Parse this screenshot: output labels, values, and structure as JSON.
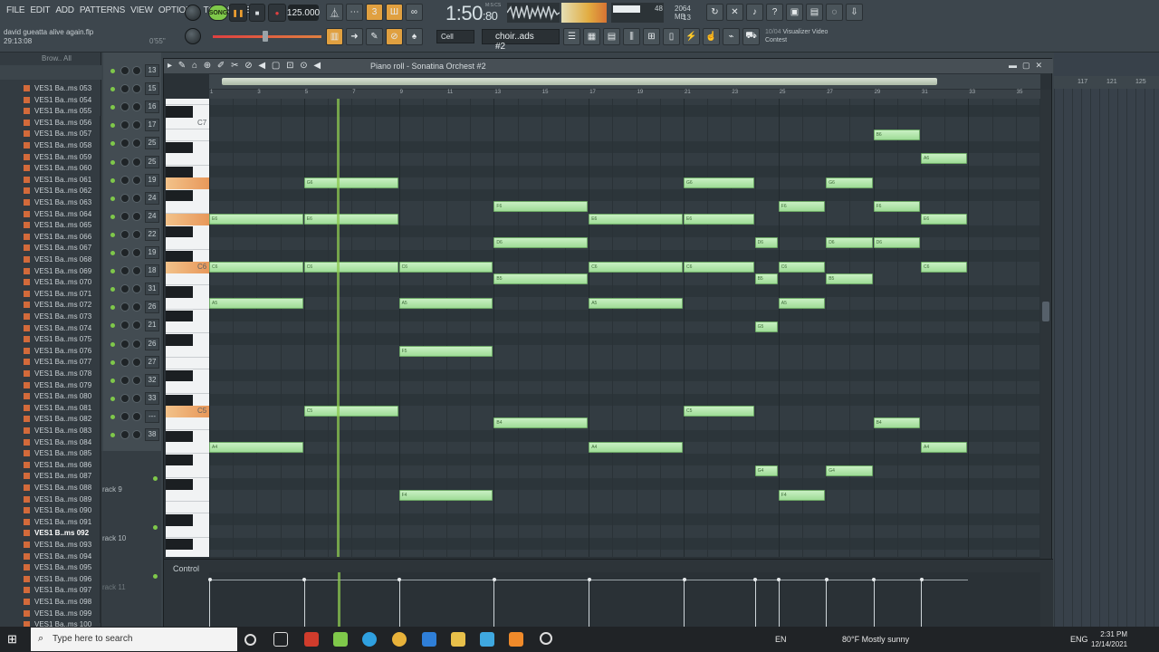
{
  "menu": [
    "FILE",
    "EDIT",
    "ADD",
    "PATTERNS",
    "VIEW",
    "OPTIONS",
    "TOOLS",
    "HELP"
  ],
  "project": {
    "name": "david gueatta alive again.flp",
    "time": "29:13:08",
    "time_right": "0'55\""
  },
  "transport": {
    "song_label": "SONG",
    "tempo": "125.000",
    "time": "1:50",
    "time_small": ":80",
    "time_units": "M:S:CS"
  },
  "cpu": {
    "value": "48",
    "polyphony": "13"
  },
  "memory": {
    "mb": "2064 MB"
  },
  "snap": "Cell",
  "pattern": "choir..ads #2",
  "hint": {
    "counter": "10/04",
    "text": "Visualizer Video",
    "text2": "Contest"
  },
  "browser": {
    "header": "Brow.. All",
    "items": [
      "VES1 Ba..ms 053",
      "VES1 Ba..ms 054",
      "VES1 Ba..ms 055",
      "VES1 Ba..ms 056",
      "VES1 Ba..ms 057",
      "VES1 Ba..ms 058",
      "VES1 Ba..ms 059",
      "VES1 Ba..ms 060",
      "VES1 Ba..ms 061",
      "VES1 Ba..ms 062",
      "VES1 Ba..ms 063",
      "VES1 Ba..ms 064",
      "VES1 Ba..ms 065",
      "VES1 Ba..ms 066",
      "VES1 Ba..ms 067",
      "VES1 Ba..ms 068",
      "VES1 Ba..ms 069",
      "VES1 Ba..ms 070",
      "VES1 Ba..ms 071",
      "VES1 Ba..ms 072",
      "VES1 Ba..ms 073",
      "VES1 Ba..ms 074",
      "VES1 Ba..ms 075",
      "VES1 Ba..ms 076",
      "VES1 Ba..ms 077",
      "VES1 Ba..ms 078",
      "VES1 Ba..ms 079",
      "VES1 Ba..ms 080",
      "VES1 Ba..ms 081",
      "VES1 Ba..ms 082",
      "VES1 Ba..ms 083",
      "VES1 Ba..ms 084",
      "VES1 Ba..ms 085",
      "VES1 Ba..ms 086",
      "VES1 Ba..ms 087",
      "VES1 Ba..ms 088",
      "VES1 Ba..ms 089",
      "VES1 Ba..ms 090",
      "VES1 Ba..ms 091",
      "VES1 B..ms 092",
      "VES1 Ba..ms 093",
      "VES1 Ba..ms 094",
      "VES1 Ba..ms 095",
      "VES1 Ba..ms 096",
      "VES1 Ba..ms 097",
      "VES1 Ba..ms 098",
      "VES1 Ba..ms 099",
      "VES1 Ba..ms 100"
    ],
    "selected_index": 39
  },
  "channels": [
    "13",
    "15",
    "16",
    "17",
    "25",
    "25",
    "19",
    "24",
    "24",
    "22",
    "19",
    "18",
    "31",
    "26",
    "21",
    "26",
    "27",
    "32",
    "33",
    "---",
    "38"
  ],
  "tracks": [
    "rack 9",
    "rack 10",
    "rack 11"
  ],
  "piano_roll": {
    "title": "Piano roll - Sonatina Orchest #2",
    "key_labels": [
      "C7",
      "C6",
      "C5"
    ],
    "ruler": [
      "1",
      "3",
      "5",
      "7",
      "9",
      "11",
      "13",
      "15",
      "17",
      "19",
      "21",
      "23",
      "25",
      "27",
      "29",
      "31",
      "33",
      "35"
    ],
    "control_label": "Control",
    "notes": [
      {
        "pitch": "B6",
        "start": 29,
        "len": 2
      },
      {
        "pitch": "A6",
        "start": 31,
        "len": 2
      },
      {
        "pitch": "G6",
        "start": 5,
        "len": 4
      },
      {
        "pitch": "G6",
        "start": 21,
        "len": 3
      },
      {
        "pitch": "G6",
        "start": 27,
        "len": 2
      },
      {
        "pitch": "F6",
        "start": 13,
        "len": 4
      },
      {
        "pitch": "F6",
        "start": 25,
        "len": 2
      },
      {
        "pitch": "F6",
        "start": 29,
        "len": 2
      },
      {
        "pitch": "E6",
        "start": 1,
        "len": 4
      },
      {
        "pitch": "E6",
        "start": 5,
        "len": 4
      },
      {
        "pitch": "E6",
        "start": 17,
        "len": 4
      },
      {
        "pitch": "E6",
        "start": 21,
        "len": 3
      },
      {
        "pitch": "E6",
        "start": 31,
        "len": 2
      },
      {
        "pitch": "D6",
        "start": 13,
        "len": 4
      },
      {
        "pitch": "D6",
        "start": 24,
        "len": 1
      },
      {
        "pitch": "D6",
        "start": 27,
        "len": 2
      },
      {
        "pitch": "D6",
        "start": 29,
        "len": 2
      },
      {
        "pitch": "C6",
        "start": 1,
        "len": 4
      },
      {
        "pitch": "C6",
        "start": 5,
        "len": 4
      },
      {
        "pitch": "C6",
        "start": 9,
        "len": 4
      },
      {
        "pitch": "C6",
        "start": 17,
        "len": 4
      },
      {
        "pitch": "C6",
        "start": 21,
        "len": 3
      },
      {
        "pitch": "C6",
        "start": 25,
        "len": 2
      },
      {
        "pitch": "C6",
        "start": 31,
        "len": 2
      },
      {
        "pitch": "B5",
        "start": 13,
        "len": 4
      },
      {
        "pitch": "B5",
        "start": 24,
        "len": 1
      },
      {
        "pitch": "B5",
        "start": 27,
        "len": 2
      },
      {
        "pitch": "A5",
        "start": 1,
        "len": 4
      },
      {
        "pitch": "A5",
        "start": 9,
        "len": 4
      },
      {
        "pitch": "A5",
        "start": 17,
        "len": 4
      },
      {
        "pitch": "A5",
        "start": 25,
        "len": 2
      },
      {
        "pitch": "G5",
        "start": 24,
        "len": 1
      },
      {
        "pitch": "F5",
        "start": 9,
        "len": 4
      },
      {
        "pitch": "C5",
        "start": 5,
        "len": 4
      },
      {
        "pitch": "C5",
        "start": 21,
        "len": 3
      },
      {
        "pitch": "B4",
        "start": 13,
        "len": 4
      },
      {
        "pitch": "B4",
        "start": 29,
        "len": 2
      },
      {
        "pitch": "A4",
        "start": 1,
        "len": 4
      },
      {
        "pitch": "A4",
        "start": 17,
        "len": 4
      },
      {
        "pitch": "A4",
        "start": 31,
        "len": 2
      },
      {
        "pitch": "G4",
        "start": 24,
        "len": 1
      },
      {
        "pitch": "G4",
        "start": 27,
        "len": 2
      },
      {
        "pitch": "F4",
        "start": 9,
        "len": 4
      },
      {
        "pitch": "F4",
        "start": 25,
        "len": 2
      }
    ],
    "playhead_bar": 6.4
  },
  "playlist_ruler": [
    "117",
    "121",
    "125"
  ],
  "taskbar": {
    "search_placeholder": "Type here to search",
    "lang": "EN",
    "weather": "80°F  Mostly sunny",
    "input_lang": "ENG",
    "time": "2:31 PM",
    "date": "12/14/2021"
  }
}
